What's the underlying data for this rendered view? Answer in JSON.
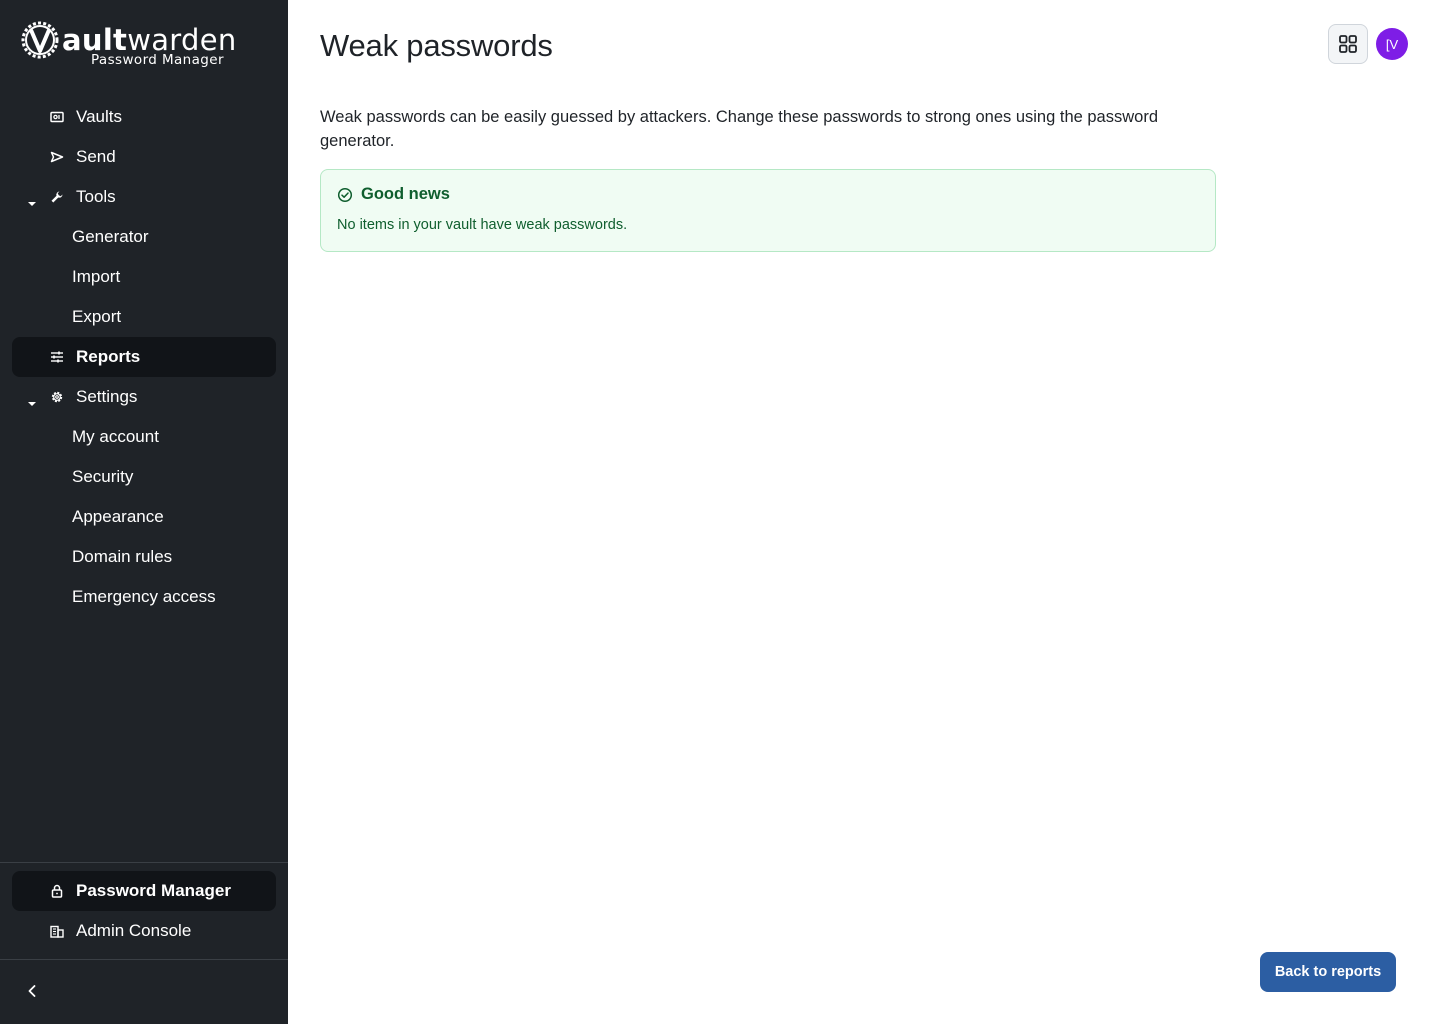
{
  "brand": {
    "word_bold": "ault",
    "word_regular": "warden",
    "subtitle": "Password Manager"
  },
  "sidebar": {
    "items": [
      {
        "label": "Vaults",
        "icon": "vault-icon"
      },
      {
        "label": "Send",
        "icon": "send-icon"
      },
      {
        "label": "Tools",
        "icon": "wrench-icon",
        "expanded": true
      },
      {
        "label": "Generator"
      },
      {
        "label": "Import"
      },
      {
        "label": "Export"
      },
      {
        "label": "Reports",
        "icon": "sliders-icon",
        "active": true
      },
      {
        "label": "Settings",
        "icon": "gear-icon",
        "expanded": true
      },
      {
        "label": "My account"
      },
      {
        "label": "Security"
      },
      {
        "label": "Appearance"
      },
      {
        "label": "Domain rules"
      },
      {
        "label": "Emergency access"
      }
    ],
    "products": [
      {
        "label": "Password Manager",
        "icon": "lock-icon",
        "active": true
      },
      {
        "label": "Admin Console",
        "icon": "building-icon"
      }
    ]
  },
  "header": {
    "title": "Weak passwords",
    "avatar_initials": "[V"
  },
  "main": {
    "description": "Weak passwords can be easily guessed by attackers. Change these passwords to strong ones using the password generator.",
    "callout": {
      "title": "Good news",
      "body": "No items in your vault have weak passwords."
    },
    "back_button": "Back to reports"
  },
  "colors": {
    "sidebar_bg": "#1f2328",
    "active_item_bg": "#111418",
    "primary": "#2c5ea3",
    "success_text": "#0f5e2e",
    "success_bg": "#f0fcf3",
    "avatar_bg": "#7e1de6"
  }
}
